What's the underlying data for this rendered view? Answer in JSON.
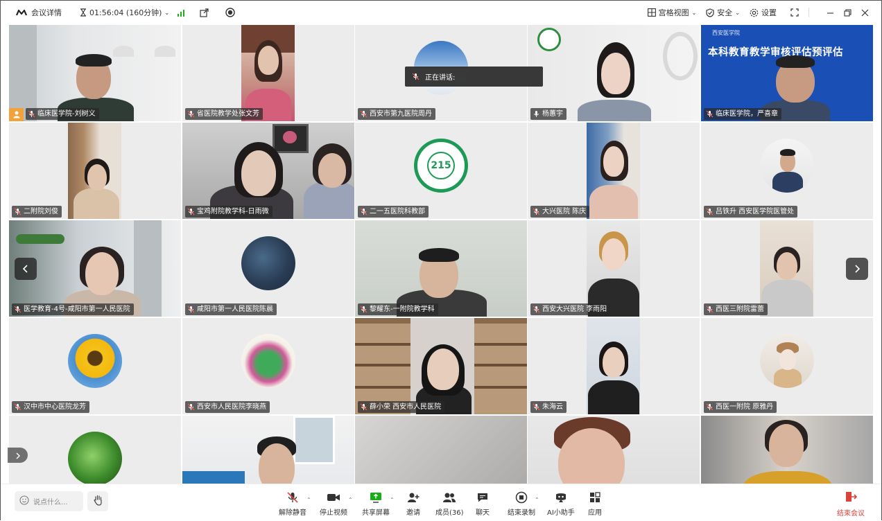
{
  "titlebar": {
    "meeting_details": "会议详情",
    "timer": "01:56:04 (160分钟)",
    "grid_view": "宫格视图",
    "security": "安全",
    "settings": "设置"
  },
  "speaking_banner": "正在讲话:",
  "participants": [
    {
      "name": "临床医学院-刘树义"
    },
    {
      "name": "省医院教学处张文芳"
    },
    {
      "name": "西安市第九医院周丹"
    },
    {
      "name": "杨蕙宇"
    },
    {
      "name": "临床医学院，严喜章"
    },
    {
      "name": "二附院刘俊"
    },
    {
      "name": "宝鸡附院教学科-日雨微"
    },
    {
      "name": "二一五医院科教部"
    },
    {
      "name": "大兴医院 陈庆"
    },
    {
      "name": "吕铁升 西安医学院医管处"
    },
    {
      "name": "医学教育-4号-咸阳市第一人民医院"
    },
    {
      "name": "咸阳市第一人民医院陈晨"
    },
    {
      "name": "黎耀东-一附院教学科"
    },
    {
      "name": "西安大兴医院 李雨阳"
    },
    {
      "name": "西医三附院雷蕾"
    },
    {
      "name": "汉中市中心医院龙芳"
    },
    {
      "name": "西安市人民医院李晓燕"
    },
    {
      "name": "薛小荣 西安市人民医院"
    },
    {
      "name": "朱海云"
    },
    {
      "name": "西医一附院 原雅丹"
    }
  ],
  "screen_texts": {
    "slide_title": "本科教育教学审核评估预评估",
    "slide_header": "西安医学院",
    "hospital_logo_number": "215"
  },
  "toolbar": {
    "chat_placeholder": "说点什么...",
    "unmute": "解除静音",
    "stop_video": "停止视频",
    "share_screen": "共享屏幕",
    "invite": "邀请",
    "members": "成员(36)",
    "chat": "聊天",
    "end_recording": "结束录制",
    "ai_assistant": "AI小助手",
    "apps": "应用",
    "end_meeting": "结束会议"
  },
  "colors": {
    "accent_green": "#1aad19",
    "end_red": "#d9443a",
    "host_badge": "#f2a23b"
  }
}
